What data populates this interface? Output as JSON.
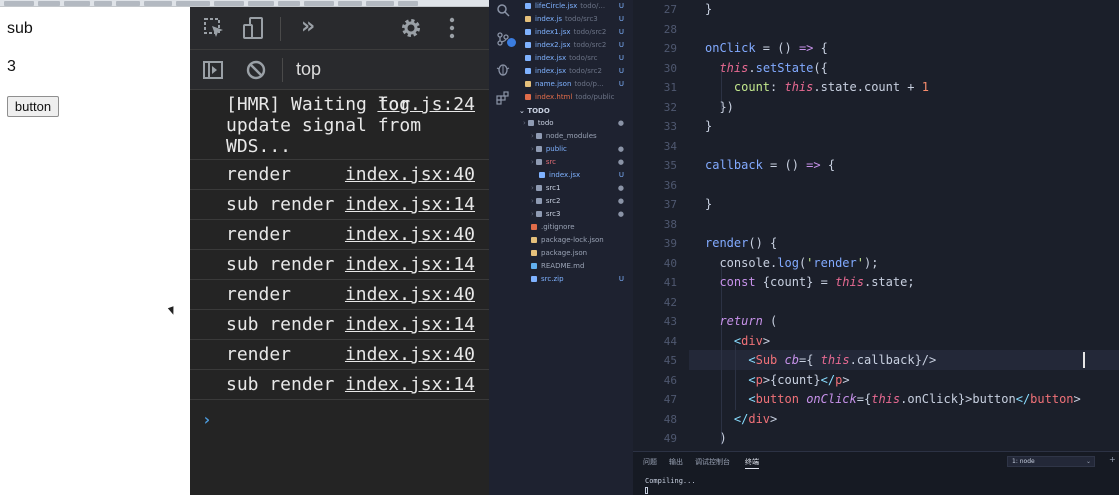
{
  "browser_page": {
    "sub_text": "sub",
    "count_text": "3",
    "button_label": "button"
  },
  "devtools": {
    "context": "top",
    "toolbar_icons": [
      "inspect-icon",
      "device-toggle-icon",
      "more-tabs-icon",
      "settings-icon",
      "kebab-menu-icon"
    ],
    "console_icons": [
      "sidebar-toggle-icon",
      "clear-console-icon"
    ],
    "messages": [
      {
        "text": "[HMR] Waiting for update signal from WDS...",
        "source": "log.js:24"
      },
      {
        "text": "render",
        "source": "index.jsx:40"
      },
      {
        "text": "sub render",
        "source": "index.jsx:14"
      },
      {
        "text": "render",
        "source": "index.jsx:40"
      },
      {
        "text": "sub render",
        "source": "index.jsx:14"
      },
      {
        "text": "render",
        "source": "index.jsx:40"
      },
      {
        "text": "sub render",
        "source": "index.jsx:14"
      },
      {
        "text": "render",
        "source": "index.jsx:40"
      },
      {
        "text": "sub render",
        "source": "index.jsx:14"
      }
    ],
    "prompt_symbol": "›"
  },
  "vscode": {
    "activity_icons": [
      "search-icon",
      "source-control-icon",
      "debug-icon",
      "extensions-icon"
    ],
    "open_editors": [
      {
        "name": "lifeCircle.jsx",
        "hint": "todo/...",
        "status": "U",
        "color": "#7fb2ff"
      },
      {
        "name": "index.js",
        "hint": "todo/src3",
        "status": "U",
        "color": "#e5c07b"
      },
      {
        "name": "index1.jsx",
        "hint": "todo/src2",
        "status": "U",
        "color": "#7fb2ff"
      },
      {
        "name": "index2.jsx",
        "hint": "todo/src2",
        "status": "U",
        "color": "#7fb2ff"
      },
      {
        "name": "index.jsx",
        "hint": "todo/src",
        "status": "U",
        "color": "#7fb2ff"
      },
      {
        "name": "index.jsx",
        "hint": "todo/src2",
        "status": "U",
        "color": "#7fb2ff"
      },
      {
        "name": "name.json",
        "hint": "todo/p...",
        "status": "U",
        "color": "#e5c07b"
      },
      {
        "name": "index.html",
        "hint": "todo/public",
        "status": "",
        "color": "#e06c4a"
      }
    ],
    "section_label": "TODO",
    "tree": [
      {
        "name": "todo",
        "level": 0,
        "status": "●"
      },
      {
        "name": "node_modules",
        "level": 1,
        "status": ""
      },
      {
        "name": "public",
        "level": 1,
        "status": "●"
      },
      {
        "name": "src",
        "level": 1,
        "status": "●"
      },
      {
        "name": "index.jsx",
        "level": 2,
        "status": "U"
      },
      {
        "name": "src1",
        "level": 1,
        "status": "●"
      },
      {
        "name": "src2",
        "level": 1,
        "status": "●"
      },
      {
        "name": "src3",
        "level": 1,
        "status": "●"
      },
      {
        "name": ".gitignore",
        "level": 1,
        "status": ""
      },
      {
        "name": "package-lock.json",
        "level": 1,
        "status": ""
      },
      {
        "name": "package.json",
        "level": 1,
        "status": ""
      },
      {
        "name": "README.md",
        "level": 1,
        "status": ""
      },
      {
        "name": "src.zip",
        "level": 1,
        "status": "U"
      }
    ],
    "code_lines": [
      {
        "num": "27",
        "text": "}"
      },
      {
        "num": "28",
        "text": ""
      },
      {
        "num": "29",
        "text": "onClick = () => {"
      },
      {
        "num": "30",
        "text": "  this.setState({"
      },
      {
        "num": "31",
        "text": "    count: this.state.count + 1"
      },
      {
        "num": "32",
        "text": "  })"
      },
      {
        "num": "33",
        "text": "}"
      },
      {
        "num": "34",
        "text": ""
      },
      {
        "num": "35",
        "text": "callback = () => {"
      },
      {
        "num": "36",
        "text": ""
      },
      {
        "num": "37",
        "text": "}"
      },
      {
        "num": "38",
        "text": ""
      },
      {
        "num": "39",
        "text": "render() {"
      },
      {
        "num": "40",
        "text": "  console.log('render');"
      },
      {
        "num": "41",
        "text": "  const {count} = this.state;"
      },
      {
        "num": "42",
        "text": ""
      },
      {
        "num": "43",
        "text": "  return ("
      },
      {
        "num": "44",
        "text": "    <div>"
      },
      {
        "num": "45",
        "text": "      <Sub cb={ this.callback}/>"
      },
      {
        "num": "46",
        "text": "      <p>{count}</p>"
      },
      {
        "num": "47",
        "text": "      <button onClick={this.onClick}>button</button>"
      },
      {
        "num": "48",
        "text": "    </div>"
      },
      {
        "num": "49",
        "text": "  )"
      }
    ],
    "panel_tabs": [
      "问题",
      "输出",
      "调试控制台",
      "终端"
    ],
    "active_panel_tab": "终端",
    "terminal_select": "1: node",
    "terminal_text": "Compiling..."
  }
}
